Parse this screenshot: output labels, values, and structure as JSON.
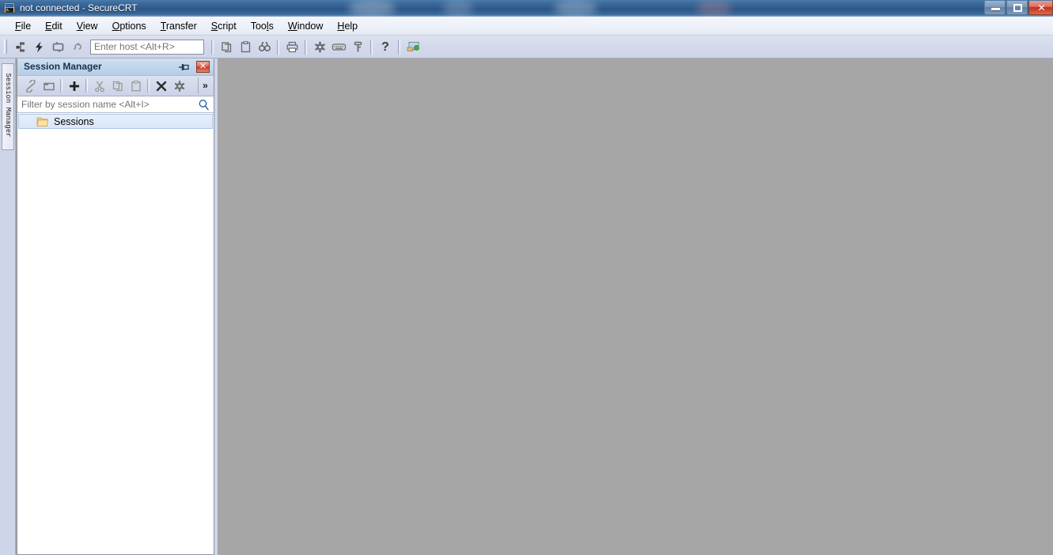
{
  "window": {
    "title": "not connected - SecureCRT",
    "icon": "securecrt-icon",
    "controls": {
      "minimize": "minimize-button",
      "maximize": "maximize-button",
      "close": "close-button",
      "minimize_glyph": "",
      "maximize_glyph": "",
      "close_glyph": "✕"
    }
  },
  "menubar": {
    "items": [
      {
        "label": "File",
        "accel": "F",
        "rest": "ile"
      },
      {
        "label": "Edit",
        "accel": "E",
        "rest": "dit"
      },
      {
        "label": "View",
        "accel": "V",
        "rest": "iew"
      },
      {
        "label": "Options",
        "accel": "O",
        "rest": "ptions"
      },
      {
        "label": "Transfer",
        "accel": "T",
        "rest": "ransfer"
      },
      {
        "label": "Script",
        "accel": "S",
        "rest": "cript"
      },
      {
        "label": "Tools",
        "accel": "l",
        "rest": "Tools"
      },
      {
        "label": "Window",
        "accel": "W",
        "rest": "indow"
      },
      {
        "label": "Help",
        "accel": "H",
        "rest": "elp"
      }
    ]
  },
  "toolbar": {
    "buttons": [
      {
        "name": "connect-icon",
        "title": "Connect"
      },
      {
        "name": "quick-connect-icon",
        "title": "Quick Connect"
      },
      {
        "name": "connect-in-tab-icon",
        "title": "Connect in Tab"
      },
      {
        "name": "reconnect-icon",
        "title": "Reconnect"
      }
    ],
    "host_input": {
      "name": "host-input",
      "value": "",
      "placeholder": "Enter host <Alt+R>"
    },
    "buttons2": [
      {
        "name": "copy-icon",
        "title": "Copy"
      },
      {
        "name": "paste-icon",
        "title": "Paste"
      },
      {
        "name": "find-icon",
        "title": "Find"
      }
    ],
    "buttons3": [
      {
        "name": "print-icon",
        "title": "Print"
      }
    ],
    "buttons4": [
      {
        "name": "gear-icon",
        "title": "Session Options"
      },
      {
        "name": "keyboard-icon",
        "title": "Keymap Editor"
      },
      {
        "name": "key-icon",
        "title": "Public Key"
      }
    ],
    "buttons5": [
      {
        "name": "help-icon",
        "title": "Help",
        "glyph": "?"
      }
    ],
    "buttons6": [
      {
        "name": "session-options-icon",
        "title": "Session Options"
      }
    ]
  },
  "side_tab": {
    "label": "Session Manager",
    "name": "side-tab-session-manager"
  },
  "session_manager": {
    "title": "Session Manager",
    "pin": {
      "name": "auto-hide-pin-icon",
      "title": "Auto Hide"
    },
    "close": {
      "name": "close-panel-button",
      "glyph": "✕"
    },
    "toolbar": [
      {
        "name": "connect-session-icon",
        "title": "Connect session"
      },
      {
        "name": "connect-in-tab-icon",
        "title": "Connect in tab"
      },
      {
        "name": "new-session-icon",
        "title": "New Session",
        "glyph": "+"
      },
      {
        "name": "cut-icon",
        "title": "Cut"
      },
      {
        "name": "copy-icon",
        "title": "Copy"
      },
      {
        "name": "paste-icon",
        "title": "Paste"
      },
      {
        "name": "delete-icon",
        "title": "Delete",
        "glyph": "✕"
      },
      {
        "name": "properties-gear-icon",
        "title": "Properties"
      }
    ],
    "overflow_glyph": "»",
    "filter": {
      "name": "filter-input",
      "value": "",
      "placeholder": "Filter by session name <Alt+I>"
    },
    "tree": [
      {
        "label": "Sessions",
        "icon": "folder-icon",
        "selected": true
      }
    ]
  },
  "terminal": {
    "name": "terminal-area",
    "content": "",
    "background": "#a6a6a6"
  },
  "colors": {
    "titlebar_blue": "#2f5b8c",
    "toolbar_lavender": "#d4daec",
    "panel_header_blue": "#c2d7ec",
    "terminal_gray": "#a6a6a6",
    "close_red": "#c33b22",
    "selection_blue": "#dbe7f8"
  }
}
